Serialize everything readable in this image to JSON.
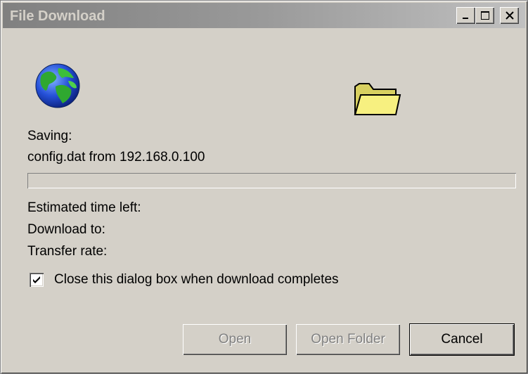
{
  "window": {
    "title": "File Download",
    "controls": {
      "minimize_icon": "minimize-icon",
      "maximize_icon": "maximize-icon",
      "close_icon": "close-icon"
    }
  },
  "icons": {
    "source": "globe-icon",
    "destination": "folder-icon"
  },
  "status": {
    "saving_label": "Saving:",
    "file_line": "config.dat  from 192.168.0.100",
    "progress_percent": 0,
    "estimated_label": "Estimated time left:",
    "download_to_label": "Download to:",
    "transfer_rate_label": "Transfer rate:"
  },
  "options": {
    "close_when_complete_label": "Close this dialog box when download completes",
    "close_when_complete_checked": true
  },
  "buttons": {
    "open": "Open",
    "open_folder": "Open Folder",
    "cancel": "Cancel"
  },
  "colors": {
    "dialog_face": "#d4d0c8",
    "title_inactive_gradient_start": "#808080",
    "title_inactive_gradient_end": "#c0c0c0",
    "disabled_text": "#808080"
  }
}
